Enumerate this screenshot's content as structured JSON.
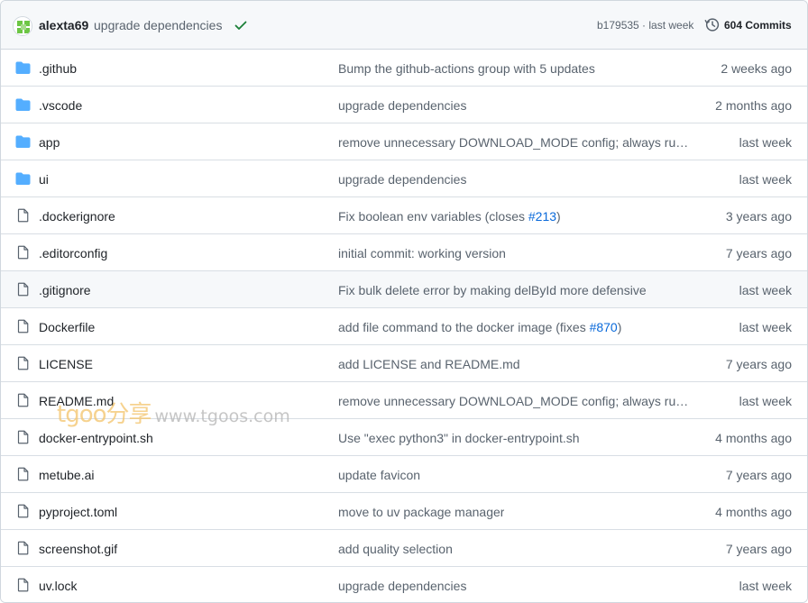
{
  "latest_commit": {
    "author": "alexta69",
    "message": "upgrade dependencies",
    "status": "success",
    "sha_time": "b179535 · last week",
    "commits_label": "604 Commits"
  },
  "colors": {
    "folder": "#54aeff",
    "file_outline": "#59636e",
    "success": "#1a7f37",
    "link": "#0969da"
  },
  "files": [
    {
      "type": "folder",
      "name": ".github",
      "message": "Bump the github-actions group with 5 updates",
      "date": "2 weeks ago"
    },
    {
      "type": "folder",
      "name": ".vscode",
      "message": "upgrade dependencies",
      "date": "2 months ago"
    },
    {
      "type": "folder",
      "name": "app",
      "message": "remove unnecessary DOWNLOAD_MODE config; always run ...",
      "date": "last week"
    },
    {
      "type": "folder",
      "name": "ui",
      "message": "upgrade dependencies",
      "date": "last week"
    },
    {
      "type": "file",
      "name": ".dockerignore",
      "message": "Fix boolean env variables (closes ",
      "message_ref": "#213",
      "message_tail": ")",
      "date": "3 years ago"
    },
    {
      "type": "file",
      "name": ".editorconfig",
      "message": "initial commit: working version",
      "date": "7 years ago"
    },
    {
      "type": "file",
      "name": ".gitignore",
      "message": "Fix bulk delete error by making delById more defensive",
      "date": "last week",
      "hover": true
    },
    {
      "type": "file",
      "name": "Dockerfile",
      "message": "add file command to the docker image (fixes ",
      "message_ref": "#870",
      "message_tail": ")",
      "date": "last week"
    },
    {
      "type": "file",
      "name": "LICENSE",
      "message": "add LICENSE and README.md",
      "date": "7 years ago"
    },
    {
      "type": "file",
      "name": "README.md",
      "message": "remove unnecessary DOWNLOAD_MODE config; always run ...",
      "date": "last week"
    },
    {
      "type": "file",
      "name": "docker-entrypoint.sh",
      "message": "Use \"exec python3\" in docker-entrypoint.sh",
      "date": "4 months ago"
    },
    {
      "type": "file",
      "name": "metube.ai",
      "message": "update favicon",
      "date": "7 years ago"
    },
    {
      "type": "file",
      "name": "pyproject.toml",
      "message": "move to uv package manager",
      "date": "4 months ago"
    },
    {
      "type": "file",
      "name": "screenshot.gif",
      "message": "add quality selection",
      "date": "7 years ago"
    },
    {
      "type": "file",
      "name": "uv.lock",
      "message": "upgrade dependencies",
      "date": "last week"
    }
  ],
  "watermark": {
    "brand": "tgoo分享",
    "url": "www.tgoos.com"
  }
}
